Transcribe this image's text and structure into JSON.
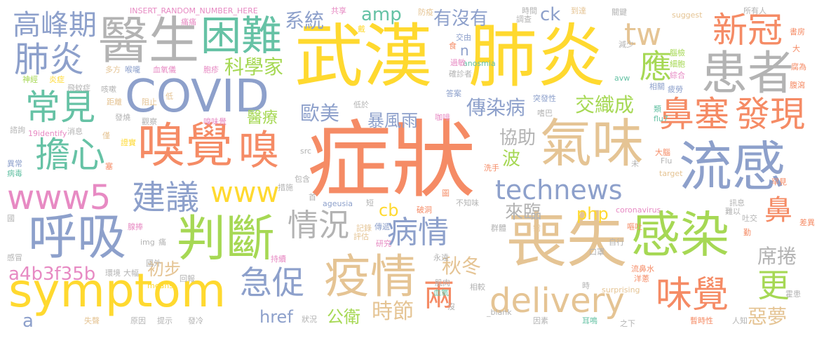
{
  "palette": {
    "orange": "#f58b65",
    "teal": "#66c2a5",
    "blue": "#8da0cb",
    "pink": "#e78ac3",
    "green": "#a6d854",
    "yellow": "#ffd92f",
    "tan": "#e5c494",
    "gray": "#b3b3b3"
  },
  "words": [
    "症狀",
    "武漢",
    "肺炎",
    "喪失",
    "流感",
    "氣味",
    "嗅覺",
    "感染",
    "symptom",
    "判斷",
    "疫情",
    "COVID",
    "呼吸",
    "醫生",
    "患者",
    "technews",
    "鼻塞",
    "發現",
    "delivery",
    "困難",
    "www5",
    "www",
    "擔心",
    "常見",
    "建議",
    "肺炎",
    "高峰期",
    "新冠",
    "味覺",
    "急促",
    "病情",
    "情況",
    "tw",
    "應",
    "科學家",
    "傳染病",
    "暴風雨",
    "交織成",
    "嗅",
    "協助",
    "來臨",
    "秋冬",
    "兩",
    "更",
    "鼻",
    "歐美",
    "系統",
    "amp",
    "有沒有",
    "ck",
    "a4b3f35b",
    "php",
    "cb",
    "醫療",
    "初步",
    "href",
    "公衛",
    "時節",
    "席捲",
    "惡夢",
    "波",
    "n",
    "a",
    "INSERT_RANDOM_NUMBER_HERE",
    "19identify",
    "anosmia",
    "ageusia",
    "coronavirus",
    "suggest",
    "surprising",
    "means",
    "img",
    "target",
    "src",
    "Flu",
    "flu7",
    "avw",
    "_blank",
    "共享",
    "防疫",
    "調查",
    "時間",
    "到達",
    "關鍵",
    "所有人",
    "書房",
    "腦檢",
    "細胞",
    "綜合",
    "相關",
    "疲勞",
    "腐為",
    "腹瀉",
    "罕見",
    "大腦",
    "類",
    "突發性",
    "嗜巴",
    "咖啡",
    "答案",
    "確診者",
    "過敏",
    "交由",
    "食",
    "痛痛",
    "戴",
    "神經",
    "炎症",
    "多方",
    "喉嚨",
    "血氧儀",
    "飛蚊症",
    "距離",
    "阻止",
    "低",
    "咳嗽",
    "胞疹",
    "觀察",
    "發燒",
    "消息",
    "諮詢",
    "僅",
    "證實",
    "嗅味覺",
    "塞",
    "異常",
    "病毒",
    "國",
    "腺捧",
    "感冒",
    "痛",
    "國外",
    "大幅",
    "環境",
    "回報",
    "失聲",
    "提示",
    "發冷",
    "狀況",
    "原因",
    "持續",
    "研究",
    "評估",
    "傳遞",
    "記錄",
    "永遠",
    "肌肉",
    "血氧",
    "沒",
    "相較",
    "因素",
    "破洞",
    "不知味",
    "短",
    "圖",
    "措施",
    "包含",
    "首",
    "低於",
    "群體",
    "需",
    "口罩",
    "嘔吐",
    "洋蔥",
    "自行",
    "流鼻水",
    "時",
    "之下",
    "暫時性",
    "耳鳴",
    "人知",
    "霍患",
    "吐交",
    "勤",
    "訊息",
    "難以",
    "差異",
    "未",
    "洗手",
    "減少",
    "大"
  ]
}
